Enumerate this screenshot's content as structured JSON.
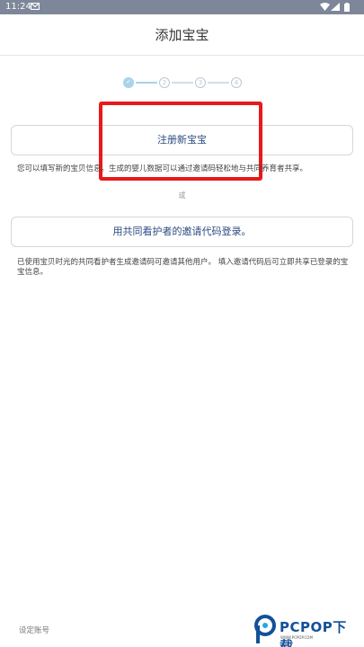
{
  "status_bar": {
    "time": "11:24"
  },
  "header": {
    "title": "添加宝宝"
  },
  "stepper": {
    "steps": [
      "✓",
      "2",
      "3",
      "4"
    ]
  },
  "register": {
    "button_label": "注册新宝宝",
    "description": "您可以填写新的宝贝信息。生成的婴儿数据可以通过邀请码轻松地与共同养育者共享。"
  },
  "or_text": "或",
  "invite": {
    "button_label": "用共同看护者的邀请代码登录。",
    "description": "已使用宝贝时光的共同看护者生成邀请码可邀请其他用户。 填入邀请代码后可立即共享已登录的宝宝信息。"
  },
  "footer": {
    "settings_label": "设定账号"
  },
  "watermark": {
    "brand": "PCPOP下载",
    "sub": "WWW.PCPOP.COM"
  },
  "colors": {
    "highlight": "#e8191b",
    "step_active": "#a9d3ea",
    "link": "#2b4b80",
    "status_bar": "#7d8799"
  }
}
